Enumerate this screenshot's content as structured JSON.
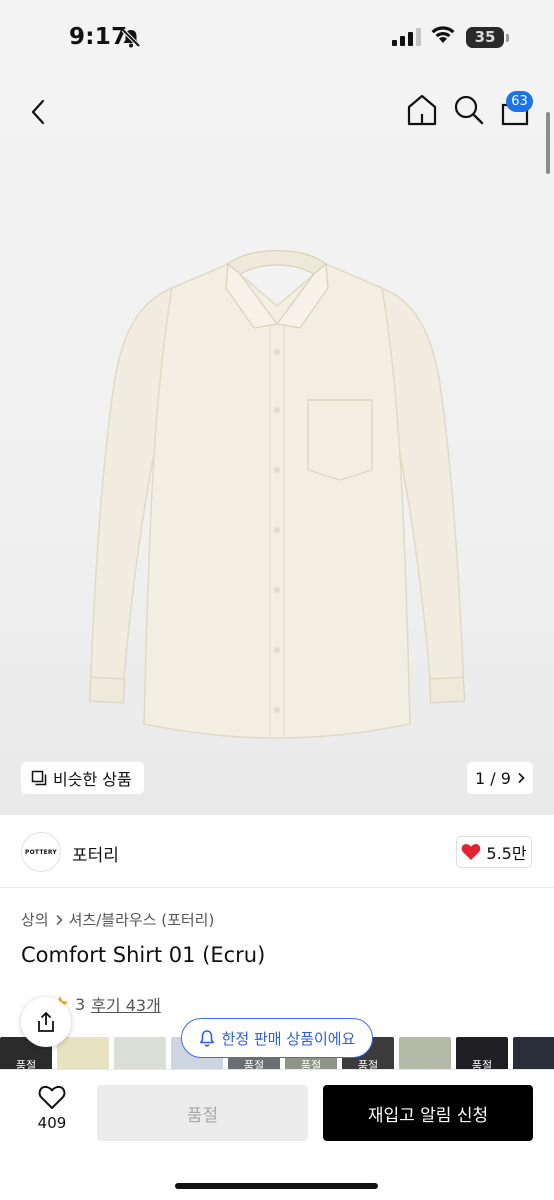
{
  "status_bar": {
    "time": "9:17",
    "battery_percent": "35",
    "battery_level_fraction": 0.35,
    "icons": [
      "bell-slash-icon",
      "cellular-signal-icon",
      "wifi-icon",
      "battery-icon"
    ]
  },
  "nav": {
    "icons": [
      "chevron-left-icon",
      "home-icon",
      "search-icon",
      "shopping-bag-icon"
    ],
    "cart_count": "63"
  },
  "gallery": {
    "similar_label": "비슷한 상품",
    "counter": "1 / 9",
    "similar_icon": "copy-icon",
    "next_icon": "chevron-right-icon"
  },
  "brand": {
    "logo_text": "POTTERY",
    "name": "포터리",
    "like_count": "5.5만",
    "like_icon": "heart-filled-icon"
  },
  "breadcrumb": {
    "category": "상의",
    "subcategory": "셔츠/블라우스 (포터리)"
  },
  "product": {
    "name": "Comfort Shirt 01 (Ecru)",
    "rating_partial": "3",
    "review_label": "후기 43개"
  },
  "colors": {
    "swatch_label": "품절",
    "swatches": [
      {
        "color": "#2b2b2b",
        "sold_out": true
      },
      {
        "color": "#e7e2bf",
        "sold_out": false
      },
      {
        "color": "#d9dfd7",
        "sold_out": false
      },
      {
        "color": "#cfd5e0",
        "sold_out": false
      },
      {
        "color": "#6a6d72",
        "sold_out": true
      },
      {
        "color": "#8f9488",
        "sold_out": true
      },
      {
        "color": "#3b3b3b",
        "sold_out": true
      },
      {
        "color": "#b5b9a8",
        "sold_out": false
      },
      {
        "color": "#1f1f24",
        "sold_out": true
      },
      {
        "color": "#2a2e3a",
        "sold_out": false
      },
      {
        "color": "#dfe3e0",
        "sold_out": false
      },
      {
        "color": "#e8eadf",
        "sold_out": false
      }
    ]
  },
  "limited": {
    "label": "한정 판매 상품이에요",
    "icon": "bell-icon",
    "accent_color": "#2f62d8"
  },
  "bottom_bar": {
    "wish_count": "409",
    "soldout_label": "품절",
    "restock_label": "재입고 알림 신청"
  }
}
